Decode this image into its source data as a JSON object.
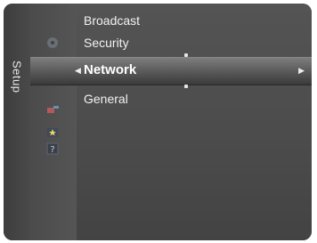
{
  "side": {
    "label": "Setup"
  },
  "menu": {
    "items": [
      {
        "label": "Broadcast"
      },
      {
        "label": "Security"
      },
      {
        "label": "Network",
        "selected": true
      },
      {
        "label": "General"
      }
    ]
  },
  "icons": {
    "top": "disc-icon",
    "selected": "gear-settings-icon",
    "sub1": "satellite-icon",
    "sub2": "star-icon",
    "sub3": "help-icon"
  },
  "colors": {
    "panel": "#4b4b4b",
    "text": "#f2f2f2",
    "selected_text": "#ffffff"
  }
}
